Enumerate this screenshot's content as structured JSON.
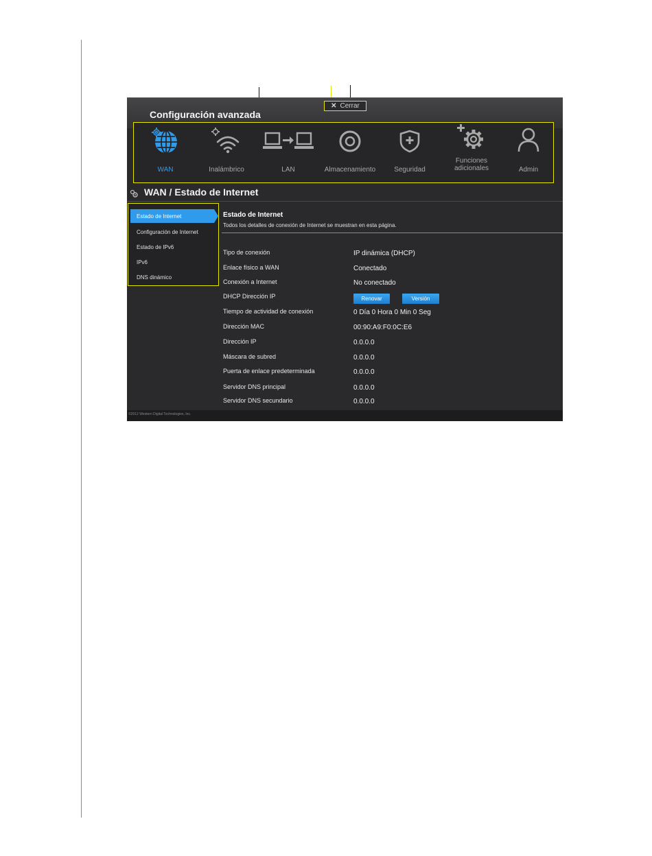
{
  "app": {
    "title": "Configuración avanzada",
    "close_label": "Cerrar"
  },
  "nav": [
    {
      "label": "WAN",
      "icon": "globe-icon",
      "active": true
    },
    {
      "label": "Inalámbrico",
      "icon": "wifi-icon"
    },
    {
      "label": "LAN",
      "icon": "lan-icon"
    },
    {
      "label": "Almacenamiento",
      "icon": "disc-icon"
    },
    {
      "label": "Seguridad",
      "icon": "shield-icon"
    },
    {
      "label": "Funciones\nadicionales",
      "icon": "addon-gear-icon"
    },
    {
      "label": "Admin",
      "icon": "user-icon"
    }
  ],
  "section": {
    "title": "WAN / Estado de Internet"
  },
  "sidemenu": [
    {
      "label": "Estado de Internet"
    },
    {
      "label": "Configuración de Internet"
    },
    {
      "label": "Estado de IPv6"
    },
    {
      "label": "IPv6"
    },
    {
      "label": "DNS dinámico"
    }
  ],
  "content": {
    "title": "Estado de Internet",
    "description": "Todos los detalles de conexión de Internet se muestran en esta página.",
    "rows": [
      {
        "label": "Tipo de conexión",
        "value": "IP dinámica (DHCP)"
      },
      {
        "label": "Enlace físico a WAN",
        "value": "Conectado"
      },
      {
        "label": "Conexión a Internet",
        "value": "No conectado"
      },
      {
        "label": "DHCP Dirección IP",
        "value": ""
      },
      {
        "label": "Tiempo de actividad de conexión",
        "value": "0 Día 0 Hora 0 Min 0 Seg"
      },
      {
        "label": "Dirección MAC",
        "value": "00:90:A9:F0:0C:E6"
      },
      {
        "label": "Dirección IP",
        "value": "0.0.0.0"
      },
      {
        "label": "Máscara de subred",
        "value": "0.0.0.0"
      },
      {
        "label": "Puerta de enlace predeterminada",
        "value": "0.0.0.0"
      },
      {
        "label": "Servidor DNS principal",
        "value": "0.0.0.0"
      },
      {
        "label": "Servidor DNS secundario",
        "value": "0.0.0.0"
      }
    ],
    "renew_label": "Renovar",
    "release_label": "Versión"
  },
  "footer": {
    "copyright": "©2012 Western Digital Technologies, Inc."
  },
  "colors": {
    "accent": "#2f9bea",
    "highlight": "#e6e600",
    "background": "#2a2a2c"
  }
}
